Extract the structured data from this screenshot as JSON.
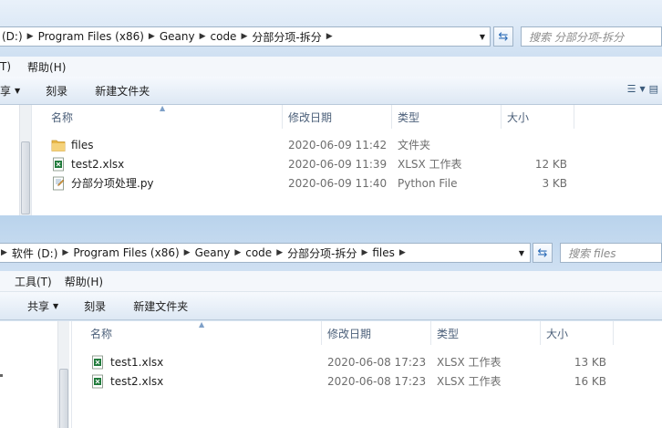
{
  "win1": {
    "path": [
      "(D:)",
      "Program Files (x86)",
      "Geany",
      "code",
      "分部分项-拆分"
    ],
    "search_placeholder": "搜索 分部分项-拆分",
    "menu": [
      "T)",
      "帮助(H)"
    ],
    "toolbar": {
      "share": "享",
      "burn": "刻录",
      "new_folder": "新建文件夹"
    },
    "columns": {
      "name": "名称",
      "date": "修改日期",
      "type": "类型",
      "size": "大小"
    },
    "files": [
      {
        "name": "files",
        "date": "2020-06-09 11:42",
        "type": "文件夹",
        "size": "",
        "icon": "folder-icon"
      },
      {
        "name": "test2.xlsx",
        "date": "2020-06-09 11:39",
        "type": "XLSX 工作表",
        "size": "12 KB",
        "icon": "xlsx-file-icon"
      },
      {
        "name": "分部分项处理.py",
        "date": "2020-06-09 11:40",
        "type": "Python File",
        "size": "3 KB",
        "icon": "python-file-icon"
      }
    ]
  },
  "win2": {
    "path": [
      "软件 (D:)",
      "Program Files (x86)",
      "Geany",
      "code",
      "分部分项-拆分",
      "files"
    ],
    "search_placeholder": "搜索 files",
    "menu": [
      "工具(T)",
      "帮助(H)"
    ],
    "toolbar": {
      "share": "共享",
      "burn": "刻录",
      "new_folder": "新建文件夹"
    },
    "columns": {
      "name": "名称",
      "date": "修改日期",
      "type": "类型",
      "size": "大小"
    },
    "files": [
      {
        "name": "test1.xlsx",
        "date": "2020-06-08 17:23",
        "type": "XLSX 工作表",
        "size": "13 KB",
        "icon": "xlsx-file-icon"
      },
      {
        "name": "test2.xlsx",
        "date": "2020-06-08 17:23",
        "type": "XLSX 工作表",
        "size": "16 KB",
        "icon": "xlsx-file-icon"
      }
    ]
  },
  "colors": {
    "accent": "#2a6bb7",
    "excel_green": "#1f7a3a",
    "folder_yellow": "#e8b84a"
  }
}
